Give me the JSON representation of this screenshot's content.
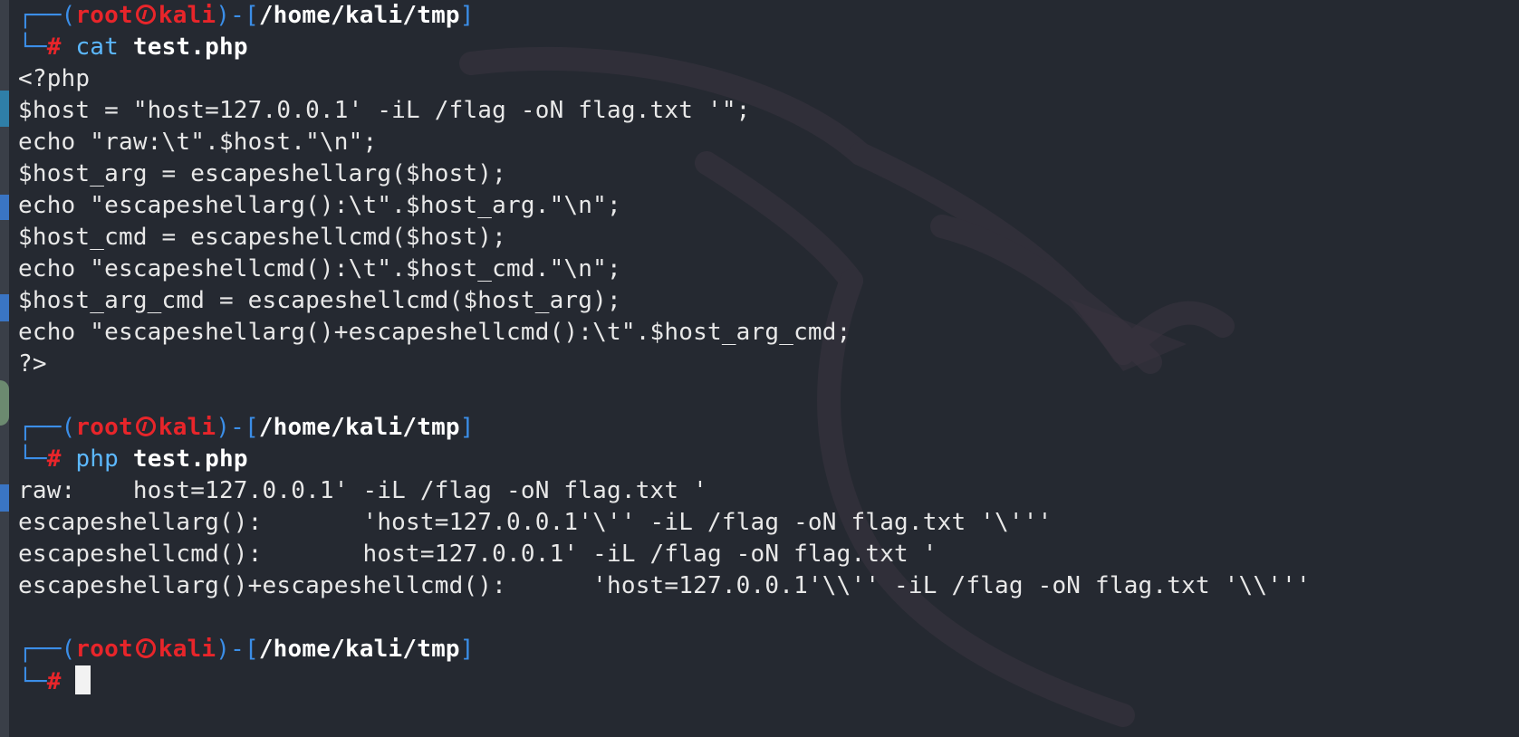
{
  "prompt": {
    "user": "root",
    "host": "kali",
    "path": "/home/kali/tmp",
    "corner_top": "┌──(",
    "sep_close": ")-[",
    "bracket_close": "]",
    "corner_bottom": "└─",
    "hash": "#"
  },
  "session1": {
    "command": "cat",
    "argument": "test.php",
    "output": [
      "<?php",
      "$host = \"host=127.0.0.1' -iL /flag -oN flag.txt '\";",
      "echo \"raw:\\t\".$host.\"\\n\";",
      "$host_arg = escapeshellarg($host);",
      "echo \"escapeshellarg():\\t\".$host_arg.\"\\n\";",
      "$host_cmd = escapeshellcmd($host);",
      "echo \"escapeshellcmd():\\t\".$host_cmd.\"\\n\";",
      "$host_arg_cmd = escapeshellcmd($host_arg);",
      "echo \"escapeshellarg()+escapeshellcmd():\\t\".$host_arg_cmd;",
      "?>"
    ]
  },
  "session2": {
    "command": "php",
    "argument": "test.php",
    "output": [
      "raw:    host=127.0.0.1' -iL /flag -oN flag.txt '",
      "escapeshellarg():       'host=127.0.0.1'\\'' -iL /flag -oN flag.txt '\\'''",
      "escapeshellcmd():       host=127.0.0.1' -iL /flag -oN flag.txt '",
      "escapeshellarg()+escapeshellcmd():      'host=127.0.0.1'\\\\'' -iL /flag -oN flag.txt '\\\\'''"
    ]
  },
  "colors": {
    "background": "#252931",
    "prompt_frame": "#3b8ee8",
    "prompt_user": "#e8252a",
    "command": "#5cb8ff",
    "text": "#e8e8e8"
  },
  "icons": {
    "kali_separator": "kali-skull-icon",
    "watermark": "kali-dragon-watermark-icon"
  }
}
